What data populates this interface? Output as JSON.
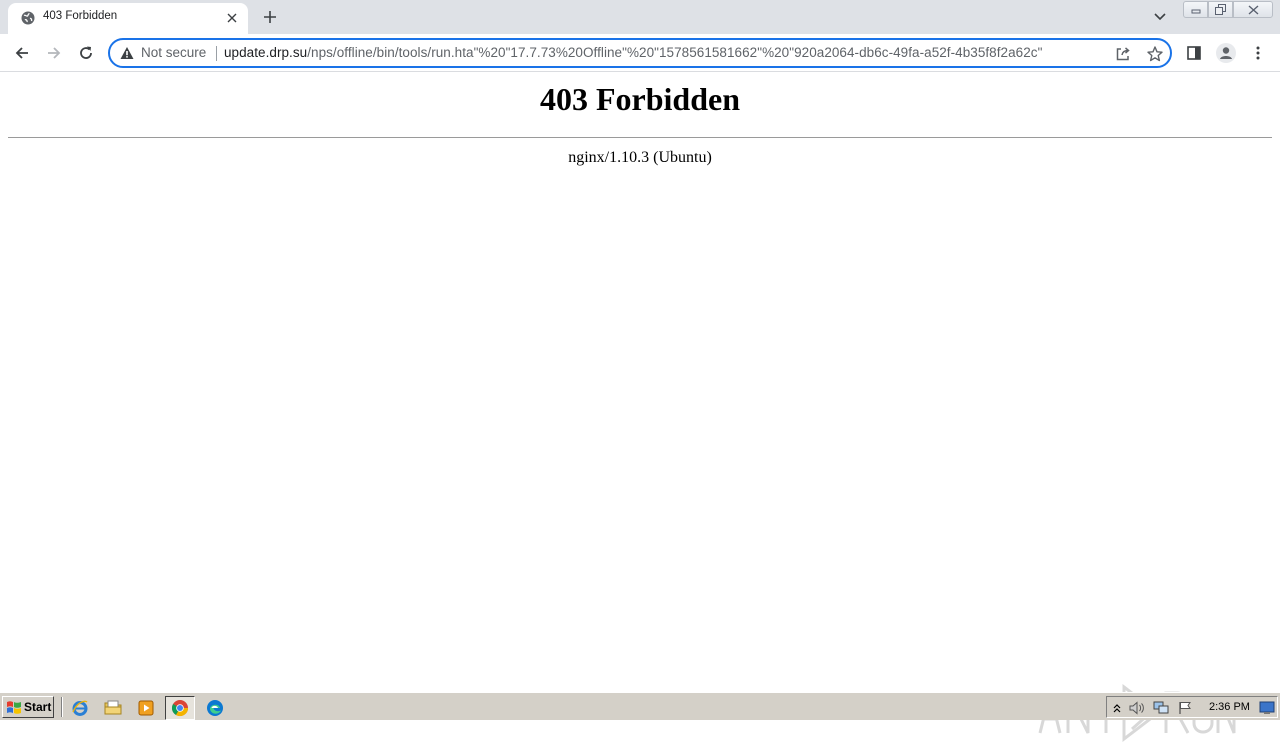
{
  "browser": {
    "tab": {
      "title": "403 Forbidden",
      "favicon": "globe-icon"
    },
    "omnibox": {
      "security_label": "Not secure",
      "url_host": "update.drp.su",
      "url_path": "/nps/offline/bin/tools/run.hta\"%20\"17.7.73%20Offline\"%20\"1578561581662\"%20\"920a2064-db6c-49fa-a52f-4b35f8f2a62c\""
    }
  },
  "page": {
    "heading": "403 Forbidden",
    "server_signature": "nginx/1.10.3 (Ubuntu)"
  },
  "taskbar": {
    "start_label": "Start",
    "clock": "2:36 PM"
  },
  "colors": {
    "accent": "#1a73e8",
    "tabstrip": "#dee1e6",
    "taskbar": "#d4d0c8"
  }
}
